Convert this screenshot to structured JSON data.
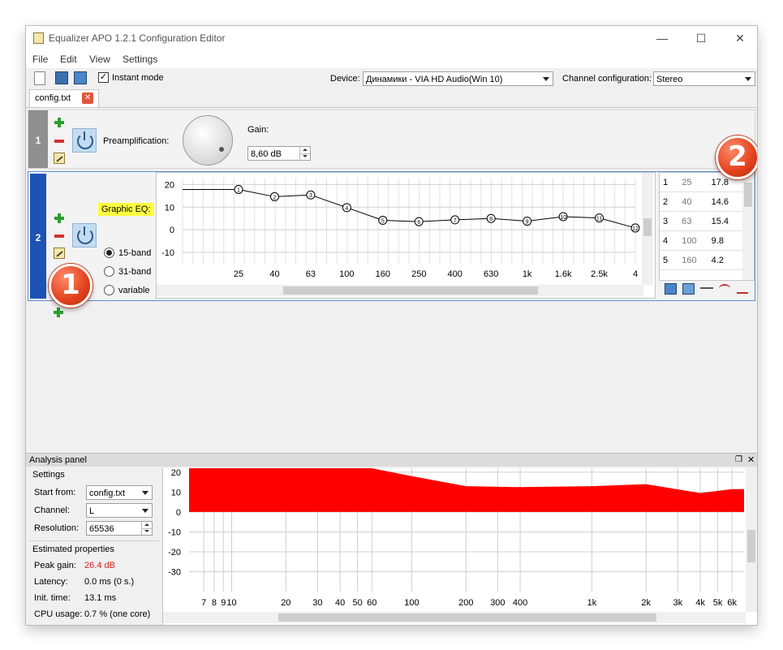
{
  "window": {
    "title": "Equalizer APO 1.2.1 Configuration Editor",
    "minimize": "—",
    "maximize": "☐",
    "close": "✕"
  },
  "menu": [
    "File",
    "Edit",
    "View",
    "Settings"
  ],
  "toolbar": {
    "instant_mode_label": "Instant mode",
    "instant_mode_checked": true,
    "device_label": "Device:",
    "device_value": "Динамики - VIA HD Audio(Win 10)",
    "channel_label": "Channel configuration:",
    "channel_value": "Stereo"
  },
  "tabs": [
    {
      "label": "config.txt"
    }
  ],
  "filters": {
    "row1": {
      "index": "1",
      "preamp_label": "Preamplification:",
      "gain_label": "Gain:",
      "gain_value": "8,60 dB"
    },
    "row2": {
      "index": "2",
      "label": "Graphic EQ:",
      "modes": [
        "15-band",
        "31-band",
        "variable"
      ],
      "selected_mode": "15-band",
      "graph": {
        "y_ticks": [
          "20",
          "10",
          "0",
          "-10"
        ],
        "x_ticks": [
          "25",
          "40",
          "63",
          "100",
          "160",
          "250",
          "400",
          "630",
          "1k",
          "1.6k",
          "2.5k",
          "4"
        ],
        "y_min": -15,
        "y_max": 23,
        "points": [
          {
            "n": "1",
            "v": 17.8
          },
          {
            "n": "2",
            "v": 14.6
          },
          {
            "n": "3",
            "v": 15.4
          },
          {
            "n": "4",
            "v": 9.8
          },
          {
            "n": "5",
            "v": 4.2
          },
          {
            "n": "6",
            "v": 3.6
          },
          {
            "n": "7",
            "v": 4.4
          },
          {
            "n": "8",
            "v": 5.0
          },
          {
            "n": "9",
            "v": 3.8
          },
          {
            "n": "10",
            "v": 5.8
          },
          {
            "n": "11",
            "v": 5.2
          },
          {
            "n": "12",
            "v": 0.8
          }
        ]
      },
      "bands_table": [
        {
          "i": "1",
          "freq": "25",
          "gain": "17.8"
        },
        {
          "i": "2",
          "freq": "40",
          "gain": "14.6"
        },
        {
          "i": "3",
          "freq": "63",
          "gain": "15.4"
        },
        {
          "i": "4",
          "freq": "100",
          "gain": "9.8"
        },
        {
          "i": "5",
          "freq": "160",
          "gain": "4.2"
        }
      ]
    }
  },
  "annotations": {
    "badge1": "1",
    "badge2": "2"
  },
  "analysis": {
    "title": "Analysis panel",
    "settings_title": "Settings",
    "start_from_label": "Start from:",
    "start_from_value": "config.txt",
    "channel_label": "Channel:",
    "channel_value": "L",
    "resolution_label": "Resolution:",
    "resolution_value": "65536",
    "estimated_title": "Estimated properties",
    "peak_gain_label": "Peak gain:",
    "peak_gain_value": "26.4 dB",
    "latency_label": "Latency:",
    "latency_value": "0.0 ms (0 s.)",
    "init_time_label": "Init. time:",
    "init_time_value": "13.1 ms",
    "cpu_label": "CPU usage:",
    "cpu_value": "0.7 % (one core)",
    "colors": {
      "response": "#ff0000",
      "peak": "#e02020"
    }
  },
  "chart_data": {
    "type": "area",
    "y_ticks": [
      "20",
      "10",
      "0",
      "-10",
      "-20",
      "-30"
    ],
    "x_ticks": [
      "7",
      "8",
      "9",
      "10",
      "20",
      "30",
      "40",
      "50",
      "60",
      "100",
      "200",
      "300",
      "400",
      "1k",
      "2k",
      "3k",
      "4k",
      "5k",
      "6k"
    ],
    "ylim": [
      -40,
      22
    ],
    "x": [
      5,
      10,
      20,
      60,
      100,
      200,
      400,
      1000,
      2000,
      4000,
      6000
    ],
    "series": [
      {
        "values": [
          22,
          22,
          22,
          22,
          18,
          13,
          12.5,
          13,
          14,
          9.5,
          11.5
        ]
      }
    ]
  }
}
